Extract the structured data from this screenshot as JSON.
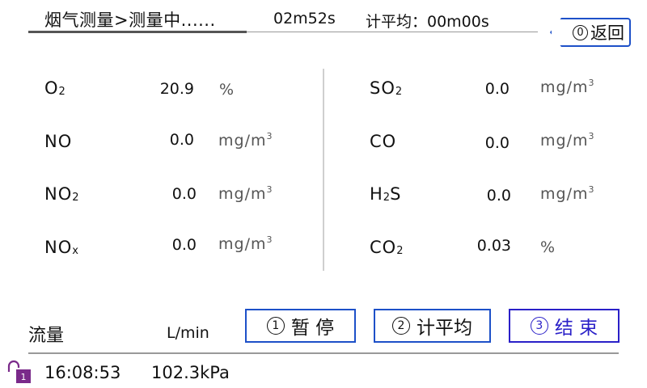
{
  "header": {
    "title": "烟气测量>测量中......",
    "elapsed": "02m52s",
    "avg_label": "计平均：00m00s",
    "back": {
      "key": "0",
      "label": "返回"
    }
  },
  "readings": {
    "left": [
      {
        "name": "O",
        "sub": "2",
        "value": "20.9",
        "unit": "%",
        "unit_sup": ""
      },
      {
        "name": "NO",
        "sub": "",
        "value": "0.0",
        "unit": "mg/m",
        "unit_sup": "3"
      },
      {
        "name": "NO",
        "sub": "2",
        "value": "0.0",
        "unit": "mg/m",
        "unit_sup": "3"
      },
      {
        "name": "NO",
        "sub": "x",
        "value": "0.0",
        "unit": "mg/m",
        "unit_sup": "3"
      }
    ],
    "right": [
      {
        "name": "SO",
        "sub": "2",
        "value": "0.0",
        "unit": "mg/m",
        "unit_sup": "3"
      },
      {
        "name": "CO",
        "sub": "",
        "value": "0.0",
        "unit": "mg/m",
        "unit_sup": "3"
      },
      {
        "name": "H",
        "sub": "2",
        "name2": "S",
        "value": "0.0",
        "unit": "mg/m",
        "unit_sup": "3"
      },
      {
        "name": "CO",
        "sub": "2",
        "value": "0.03",
        "unit": "%",
        "unit_sup": ""
      }
    ]
  },
  "flow": {
    "label": "流量",
    "unit": "L/min"
  },
  "buttons": [
    {
      "key": "1",
      "label": "暂 停"
    },
    {
      "key": "2",
      "label": "计平均"
    },
    {
      "key": "3",
      "label": "结 束"
    }
  ],
  "status": {
    "time": "16:08:53",
    "pressure": "102.3kPa",
    "lock_badge": "1"
  },
  "colors": {
    "accent": "#1d50c8",
    "end_button": "#2a20c8"
  }
}
